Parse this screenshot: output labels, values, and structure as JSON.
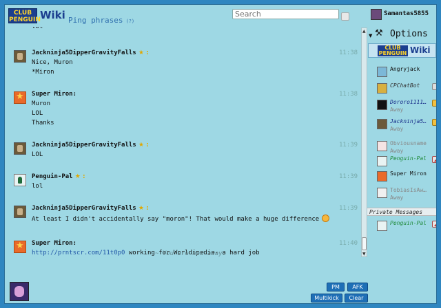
{
  "header": {
    "logo_club": "CLUB PENGUIN",
    "logo_wiki": "Wiki",
    "ping_label": "Ping phrases",
    "ping_help": "(?)",
    "search_placeholder": "Search",
    "current_user": "Samantas5855"
  },
  "messages": [
    {
      "user": "",
      "text": [
        "lol"
      ],
      "time": "",
      "avatar": "jack",
      "star": false
    },
    {
      "user": "Jackninja5DipperGravityFalls",
      "text": [
        "Nice, Muron",
        "*Miron"
      ],
      "time": "11:38",
      "avatar": "jack",
      "star": true
    },
    {
      "user": "Super Miron:",
      "text": [
        "Muron",
        "LOL",
        "Thanks"
      ],
      "time": "11:38",
      "avatar": "star",
      "star": false
    },
    {
      "user": "Jackninja5DipperGravityFalls",
      "text": [
        "LOL"
      ],
      "time": "11:39",
      "avatar": "jack",
      "star": true
    },
    {
      "user": "Penguin-Pal",
      "text": [
        "lol"
      ],
      "time": "11:39",
      "avatar": "peng",
      "star": true
    },
    {
      "user": "Jackninja5DipperGravityFalls",
      "text": [
        "At least I didn't accidentally say \"moron\"! That would make a huge difference"
      ],
      "time": "11:39",
      "avatar": "jack",
      "star": true
    },
    {
      "user": "Super Miron:",
      "link": "http://prntscr.com/11t0p0",
      "text": [
        " working for Worldipedia- a hard job"
      ],
      "time": "11:40",
      "avatar": "star",
      "star": false
    }
  ],
  "away_notice": "~ You are now away. ~",
  "sidebar": {
    "options_label": "Options",
    "users": [
      {
        "name": "Angryjack",
        "status": "",
        "color": "#111111",
        "italic": false,
        "avatar": "#7cb8d8",
        "badge": ""
      },
      {
        "name": "CPChatBot",
        "status": "",
        "color": "#333333",
        "italic": true,
        "avatar": "#d8b040",
        "badge": "gear"
      },
      {
        "name": "Dororo1111…",
        "status": "Away",
        "color": "#1a2f8a",
        "italic": true,
        "avatar": "#111111",
        "badge": "shield"
      },
      {
        "name": "Jackninja5…",
        "status": "Away",
        "color": "#1a2f8a",
        "italic": true,
        "avatar": "#6b5a3a",
        "badge": "shield"
      },
      {
        "name": "Obviousname",
        "status": "Away",
        "color": "#888888",
        "italic": false,
        "avatar": "#f4e4e4",
        "badge": ""
      },
      {
        "name": "Penguin-Pal",
        "status": "",
        "color": "#1f8a3a",
        "italic": true,
        "avatar": "#e9f3f3",
        "badge": "hammer"
      },
      {
        "name": "Super Miron",
        "status": "",
        "color": "#111111",
        "italic": false,
        "avatar": "#e96a2a",
        "badge": ""
      },
      {
        "name": "TobiasIsAw…",
        "status": "Away",
        "color": "#888888",
        "italic": false,
        "avatar": "#f0f0f0",
        "badge": ""
      }
    ],
    "private_header": "Private Messages",
    "private_users": [
      {
        "name": "Penguin-Pal",
        "color": "#1f8a3a",
        "italic": true,
        "avatar": "#e9f3f3",
        "badge": "hammer"
      }
    ]
  },
  "footer": {
    "pm_label": "PM",
    "afk_label": "AFK",
    "multikick_label": "Multikick",
    "clear_label": "Clear"
  }
}
